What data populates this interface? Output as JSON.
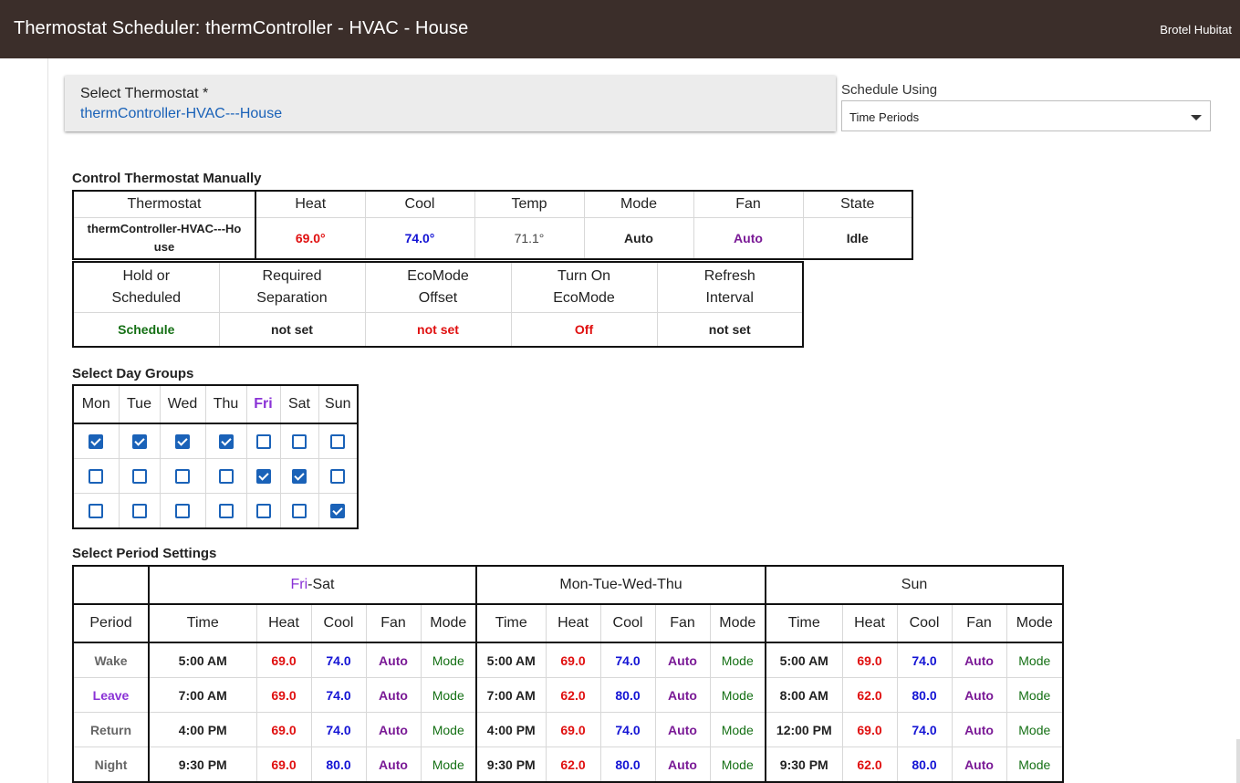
{
  "header": {
    "title": "Thermostat Scheduler: thermController - HVAC - House",
    "hub": "Brotel Hubitat"
  },
  "thermostat_select": {
    "label": "Select Thermostat *",
    "value": "thermController-HVAC---House"
  },
  "schedule_using": {
    "label": "Schedule Using",
    "value": "Time Periods"
  },
  "manual": {
    "title": "Control Thermostat Manually",
    "headers": [
      "Thermostat",
      "Heat",
      "Cool",
      "Temp",
      "Mode",
      "Fan",
      "State"
    ],
    "values": [
      "thermController-HVAC---House",
      "69.0°",
      "74.0°",
      "71.1°",
      "Auto",
      "Auto",
      "Idle"
    ],
    "headers2": [
      "Hold or Scheduled",
      "Required Separation",
      "EcoMode Offset",
      "Turn On EcoMode",
      "Refresh Interval"
    ],
    "values2": [
      "Schedule",
      "not set",
      "not set",
      "Off",
      "not set"
    ]
  },
  "day_groups": {
    "title": "Select Day Groups",
    "days": [
      "Mon",
      "Tue",
      "Wed",
      "Thu",
      "Fri",
      "Sat",
      "Sun"
    ],
    "rows": [
      [
        true,
        true,
        true,
        true,
        false,
        false,
        false
      ],
      [
        false,
        false,
        false,
        false,
        true,
        true,
        false
      ],
      [
        false,
        false,
        false,
        false,
        false,
        false,
        true
      ]
    ]
  },
  "period_settings": {
    "title": "Select Period Settings",
    "groups": [
      {
        "label_a": "Fri",
        "label_b": "-Sat"
      },
      {
        "label": "Mon-Tue-Wed-Thu"
      },
      {
        "label": "Sun"
      }
    ],
    "period_header": "Period",
    "sub_headers": [
      "Time",
      "Heat",
      "Cool",
      "Fan",
      "Mode"
    ],
    "rows": [
      {
        "name": "Wake",
        "cells": [
          [
            "5:00 AM",
            "69.0",
            "74.0",
            "Auto",
            "Mode"
          ],
          [
            "5:00 AM",
            "69.0",
            "74.0",
            "Auto",
            "Mode"
          ],
          [
            "5:00 AM",
            "69.0",
            "74.0",
            "Auto",
            "Mode"
          ]
        ]
      },
      {
        "name": "Leave",
        "cells": [
          [
            "7:00 AM",
            "69.0",
            "74.0",
            "Auto",
            "Mode"
          ],
          [
            "7:00 AM",
            "62.0",
            "80.0",
            "Auto",
            "Mode"
          ],
          [
            "8:00 AM",
            "62.0",
            "80.0",
            "Auto",
            "Mode"
          ]
        ]
      },
      {
        "name": "Return",
        "cells": [
          [
            "4:00 PM",
            "69.0",
            "74.0",
            "Auto",
            "Mode"
          ],
          [
            "4:00 PM",
            "69.0",
            "74.0",
            "Auto",
            "Mode"
          ],
          [
            "12:00 PM",
            "69.0",
            "74.0",
            "Auto",
            "Mode"
          ]
        ]
      },
      {
        "name": "Night",
        "cells": [
          [
            "9:30 PM",
            "69.0",
            "80.0",
            "Auto",
            "Mode"
          ],
          [
            "9:30 PM",
            "62.0",
            "80.0",
            "Auto",
            "Mode"
          ],
          [
            "9:30 PM",
            "62.0",
            "80.0",
            "Auto",
            "Mode"
          ]
        ]
      }
    ]
  },
  "colors": {
    "heat": "#e01010",
    "cool": "#1414d4",
    "fan": "#7a1a96",
    "mode": "#157015",
    "schedule": "#157015",
    "off": "#e01010",
    "header_bg": "#3b2e2a",
    "link": "#1a62b8"
  }
}
